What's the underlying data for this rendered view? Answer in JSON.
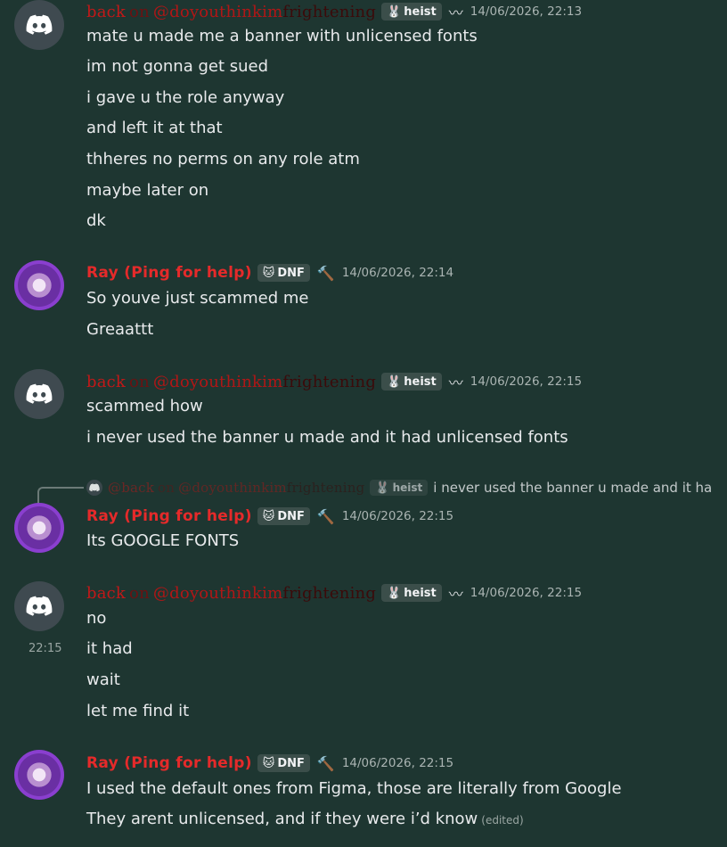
{
  "users": {
    "back": {
      "name_main": "back",
      "name_on": "on",
      "name_handle_a": "@doyouthinkim",
      "name_handle_b": "frightening",
      "tag_label": "heist",
      "tag_icon": "🐰"
    },
    "ray": {
      "name": "Ray (Ping for help)",
      "tag_label": "DNF",
      "tag_icon": "🐱"
    }
  },
  "messages": [
    {
      "author": "back",
      "timestamp": "14/06/2026, 22:13",
      "lines": [
        "mate u made me a banner with unlicensed fonts",
        "im not gonna get sued",
        "i gave u the role anyway",
        "and left it at that",
        "thheres no perms on any role atm",
        "maybe later on",
        "dk"
      ]
    },
    {
      "author": "ray",
      "timestamp": "14/06/2026, 22:14",
      "lines": [
        "So youve just scammed me",
        "Greaattt"
      ]
    },
    {
      "author": "back",
      "timestamp": "14/06/2026, 22:15",
      "lines": [
        "scammed how",
        "i never used the banner u made and it had unlicensed fonts"
      ]
    },
    {
      "author": "ray",
      "timestamp": "14/06/2026, 22:15",
      "reply": {
        "name_main": "@back",
        "text": "i never used the banner u made and it ha"
      },
      "lines": [
        "Its GOOGLE FONTS"
      ]
    },
    {
      "author": "back",
      "timestamp": "14/06/2026, 22:15",
      "hover_time": "22:15",
      "lines": [
        "no",
        "it had",
        "wait",
        "let me find it"
      ]
    },
    {
      "author": "ray",
      "timestamp": "14/06/2026, 22:15",
      "lines": [
        "I used the default ones from Figma, those are literally from Google",
        "They arent unlicensed, and if they were i’d know"
      ],
      "edited": "(edited)"
    }
  ]
}
